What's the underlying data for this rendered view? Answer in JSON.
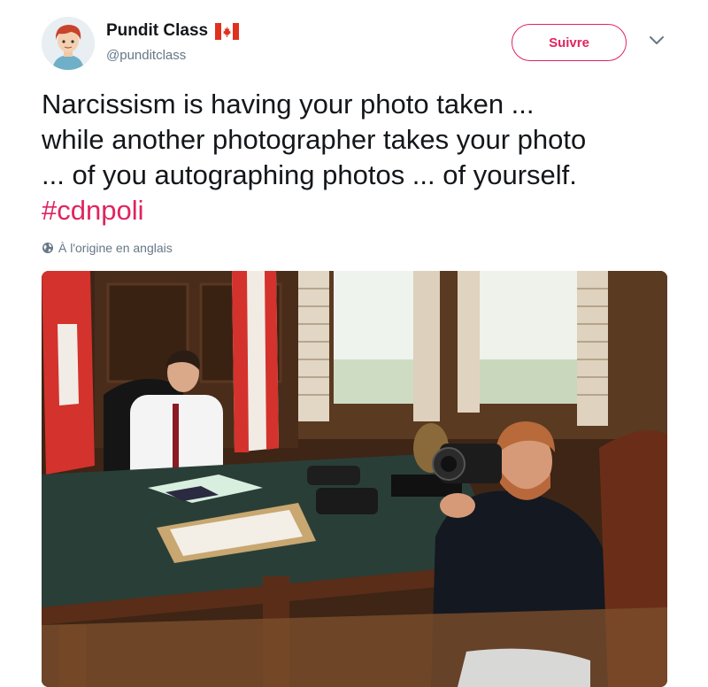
{
  "user": {
    "name": "Pundit Class",
    "handle": "@punditclass",
    "flag_icon": "canada-flag-icon",
    "avatar_icon": "cartoon-avatar-icon"
  },
  "actions": {
    "follow_label": "Suivre",
    "menu_icon": "chevron-down-icon"
  },
  "tweet": {
    "lines": [
      "Narcissism is having your photo taken ...",
      "while another photographer takes your photo",
      "... of you autographing photos ... of yourself."
    ],
    "hashtag": "#cdnpoli",
    "language_note": "À l'origine en anglais",
    "language_icon": "globe-icon"
  },
  "colors": {
    "accent": "#e0245e",
    "secondary_text": "#657786",
    "primary_text": "#14171a"
  }
}
